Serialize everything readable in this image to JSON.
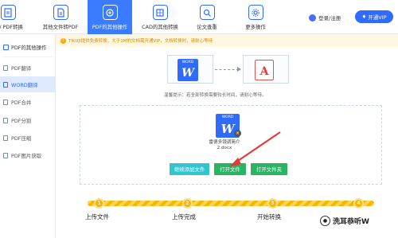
{
  "toolbar": {
    "items": [
      {
        "label": "AI / PDF转换",
        "icon": "pdf-convert-icon"
      },
      {
        "label": "其他文件转PDF",
        "icon": "file-to-pdf-icon"
      },
      {
        "label": "PDF的其他操作",
        "icon": "pdf-operations-icon"
      },
      {
        "label": "CAD的其他转换",
        "icon": "cad-convert-icon"
      },
      {
        "label": "论文查重",
        "icon": "plagiarism-check-icon"
      },
      {
        "label": "更多操作",
        "icon": "more-operations-icon"
      }
    ],
    "login_label": "登录/注册",
    "vip_label": "开通VIP"
  },
  "notice": {
    "text": "TIKUJI提供免费转换，大于1M的文档需开通VIP，文档转换时，请耐心等待"
  },
  "sidebar": {
    "header": "PDF的其他操作",
    "items": [
      {
        "label": "PDF翻译",
        "active": false
      },
      {
        "label": "WORD翻译",
        "active": true
      },
      {
        "label": "PDF合并",
        "active": false
      },
      {
        "label": "PDF分割",
        "active": false
      },
      {
        "label": "PDF压缩",
        "active": false
      },
      {
        "label": "PDF图片获取",
        "active": false
      }
    ]
  },
  "main": {
    "source_file_label": "WORD",
    "source_file_letter": "W",
    "target_file_letter": "A",
    "tip": "温馨提示：若全部转换需要较长时间，请耐心等待。",
    "file_card": {
      "top_label": "WORD",
      "letter": "W",
      "name": "雷德多镜调简介2.docx"
    },
    "buttons": {
      "add": "继续添加文件",
      "open": "打开文件",
      "folder": "打开文件夹"
    }
  },
  "steps": [
    {
      "number": "1",
      "label": "上传文件"
    },
    {
      "number": "2",
      "label": "上传完成"
    },
    {
      "number": "3",
      "label": "开始转换"
    },
    {
      "number": "4",
      "label": ""
    }
  ],
  "watermark": {
    "text": "洗耳恭听W"
  },
  "colors": {
    "accent": "#2f6bff",
    "active_tab": "#3a7bff",
    "green": "#29b363",
    "teal": "#32c5d0",
    "step": "#f7b500",
    "annotation_arrow": "#e53935"
  }
}
